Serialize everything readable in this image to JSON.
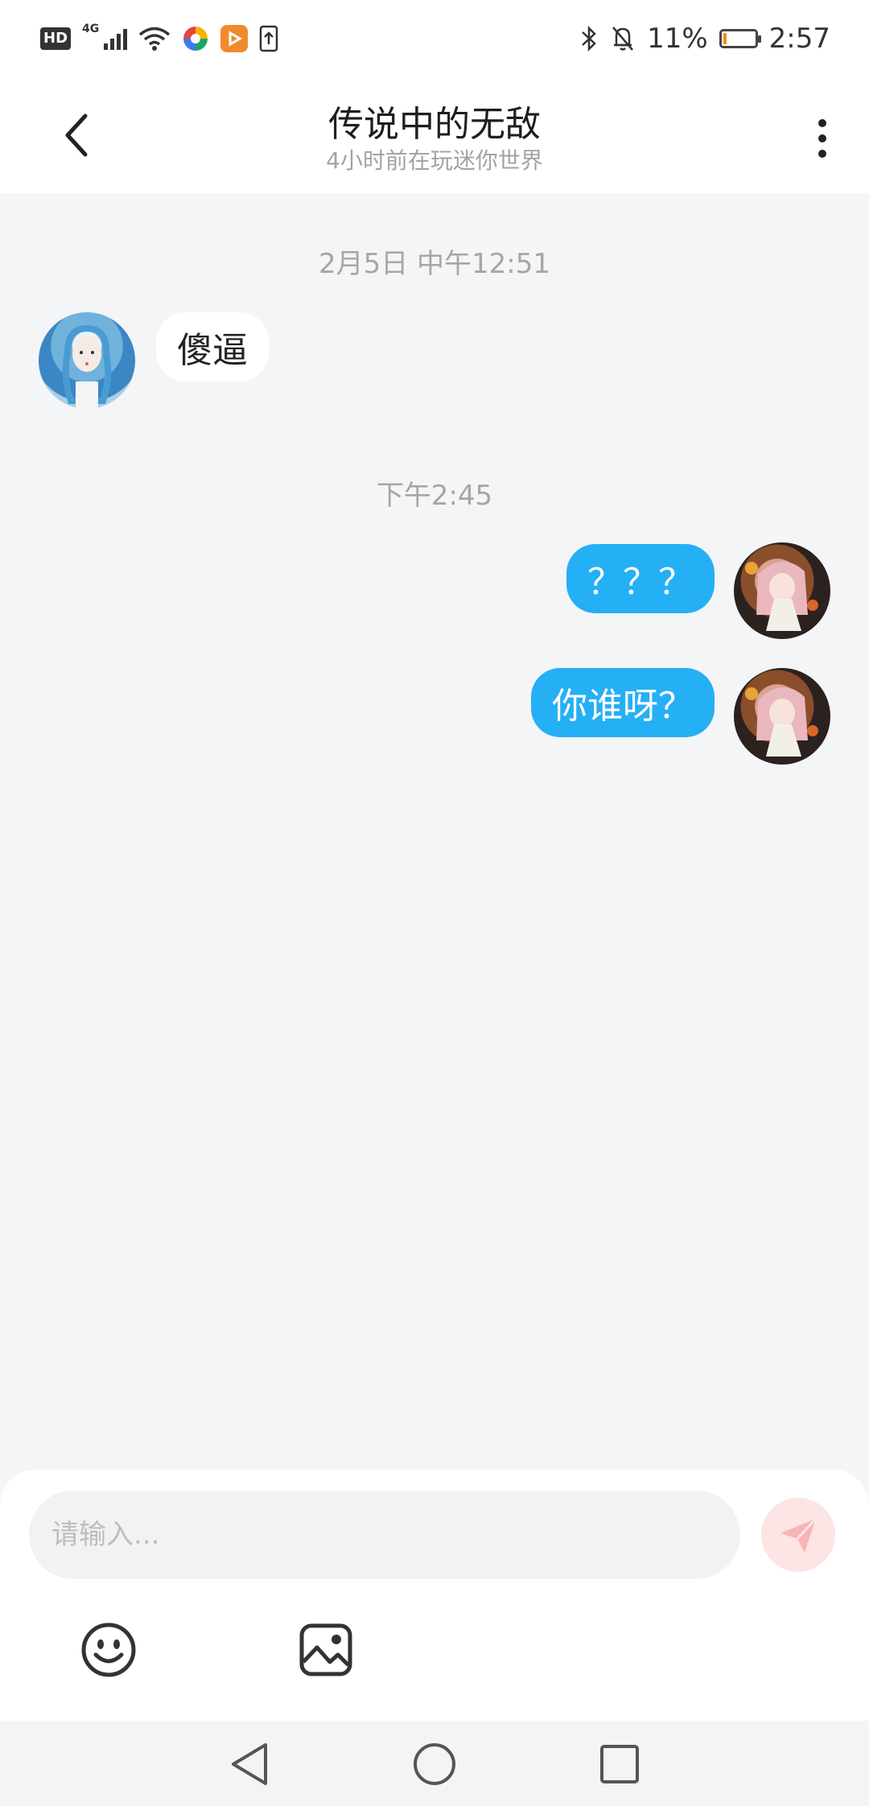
{
  "status_bar": {
    "hd": "HD",
    "network": "4G",
    "battery_percent": "11%",
    "time": "2:57",
    "battery_level": 0.11,
    "battery_color": "#f28c16",
    "icons": [
      "hd-icon",
      "signal-icon",
      "wifi-icon",
      "colorful-app-icon",
      "orange-app-icon",
      "sim-upload-icon",
      "bluetooth-icon",
      "bell-mute-icon",
      "battery-icon"
    ]
  },
  "header": {
    "title": "传说中的无敌",
    "subtitle": "4小时前在玩迷你世界"
  },
  "messages": {
    "time_1": "2月5日 中午12:51",
    "incoming_1": "傻逼",
    "time_2": "下午2:45",
    "outgoing_1": "？？？",
    "outgoing_2": "你谁呀？"
  },
  "composer": {
    "placeholder": "请输入...",
    "send_color": "#fde4e5",
    "tools": [
      "emoji-icon",
      "image-icon"
    ]
  },
  "colors": {
    "outgoing_bubble": "#25aff5",
    "background": "#f4f5f7"
  }
}
